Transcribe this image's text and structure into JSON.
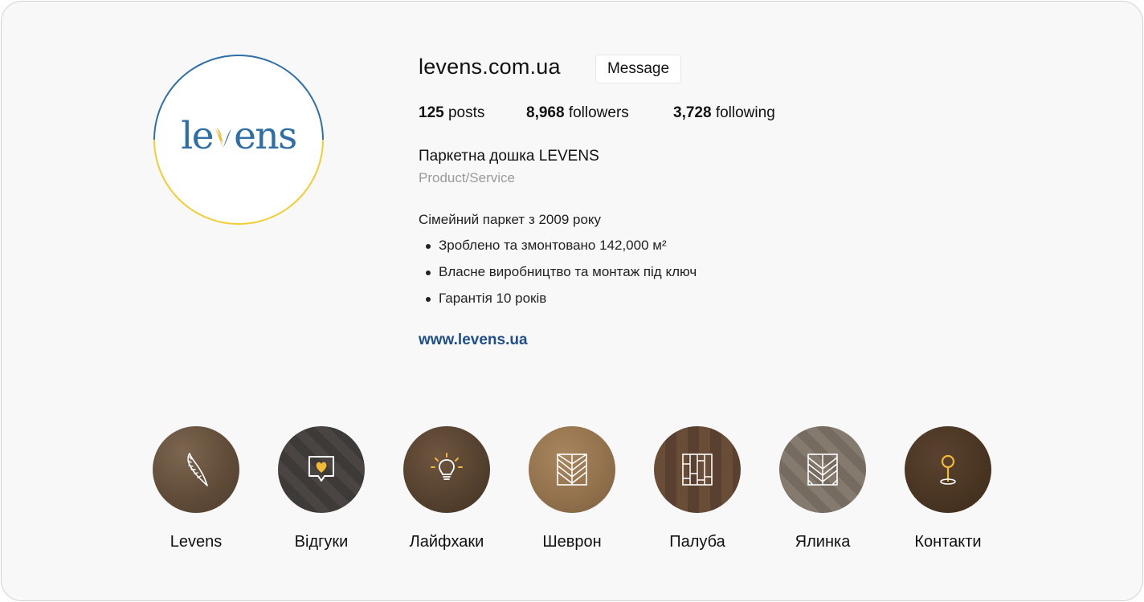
{
  "profile": {
    "username": "levens.com.ua",
    "message_label": "Message",
    "logo": {
      "prefix": "le",
      "suffix": "ens",
      "brand_blue": "#2f6fa8",
      "brand_yellow": "#f2cd34"
    },
    "stats": {
      "posts": {
        "count": "125",
        "label": "posts"
      },
      "followers": {
        "count": "8,968",
        "label": "followers"
      },
      "following": {
        "count": "3,728",
        "label": "following"
      }
    },
    "full_name": "Паркетна дошка LEVENS",
    "category": "Product/Service",
    "bio_intro": "Сімейний паркет з 2009 року",
    "bio_bullets": [
      "Зроблено та змонтовано 142,000 м²",
      "Власне виробництво та монтаж під ключ",
      "Гарантія 10 років"
    ],
    "website": "www.levens.ua"
  },
  "highlights": [
    {
      "label": "Levens",
      "icon": "leaf-icon"
    },
    {
      "label": "Відгуки",
      "icon": "heart-message-icon"
    },
    {
      "label": "Лайфхаки",
      "icon": "lightbulb-icon"
    },
    {
      "label": "Шеврон",
      "icon": "chevron-pattern-icon"
    },
    {
      "label": "Палуба",
      "icon": "deck-pattern-icon"
    },
    {
      "label": "Ялинка",
      "icon": "herringbone-pattern-icon"
    },
    {
      "label": "Контакти",
      "icon": "location-pin-icon"
    }
  ],
  "colors": {
    "accent_yellow": "#f2b936",
    "link": "#1f4e8c",
    "muted": "#9a9a9a"
  }
}
